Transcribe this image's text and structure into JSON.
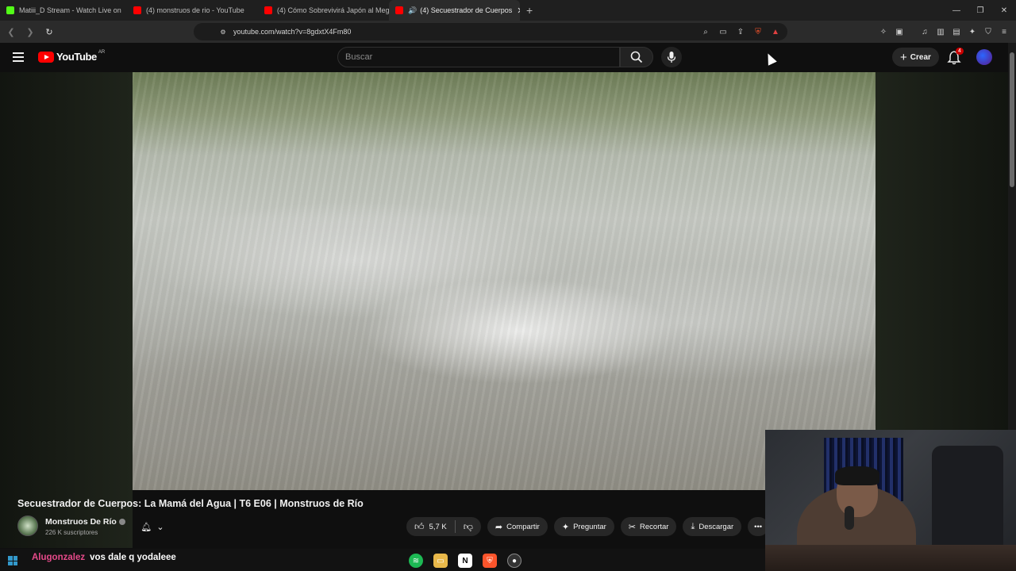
{
  "browser": {
    "tabs": [
      {
        "label": "Matiii_D Stream - Watch Live on",
        "color": "#53fc18",
        "active": false
      },
      {
        "label": "(4) monstruos de rio - YouTube",
        "color": "#ff0000",
        "active": false
      },
      {
        "label": "(4) Cómo Sobrevivirá Japón al Mega",
        "color": "#ff0000",
        "active": false
      },
      {
        "label": "(4) Secuestrador de Cuerpos",
        "color": "#ff0000",
        "active": true
      }
    ],
    "new_tab": "+",
    "url": "youtube.com/watch?v=8gdxtX4Fm80"
  },
  "youtube": {
    "logo_text": "YouTube",
    "country_code": "AR",
    "search_placeholder": "Buscar",
    "create_label": "Crear",
    "notification_count": "4"
  },
  "video": {
    "title": "Secuestrador de Cuerpos: La Mamá del Agua | T6 E06 | Monstruos de Río",
    "channel_name": "Monstruos De Río",
    "subscribers": "226 K suscriptores",
    "likes": "5,7 K",
    "actions": {
      "share": "Compartir",
      "ask": "Preguntar",
      "clip": "Recortar",
      "download": "Descargar"
    }
  },
  "stream_chat": {
    "user": "Alugonzalez",
    "message": "vos dale q yodaleee"
  },
  "colors": {
    "yt_red": "#ff0000",
    "background": "#0f0f0f",
    "chat_username": "#e64a8a"
  }
}
